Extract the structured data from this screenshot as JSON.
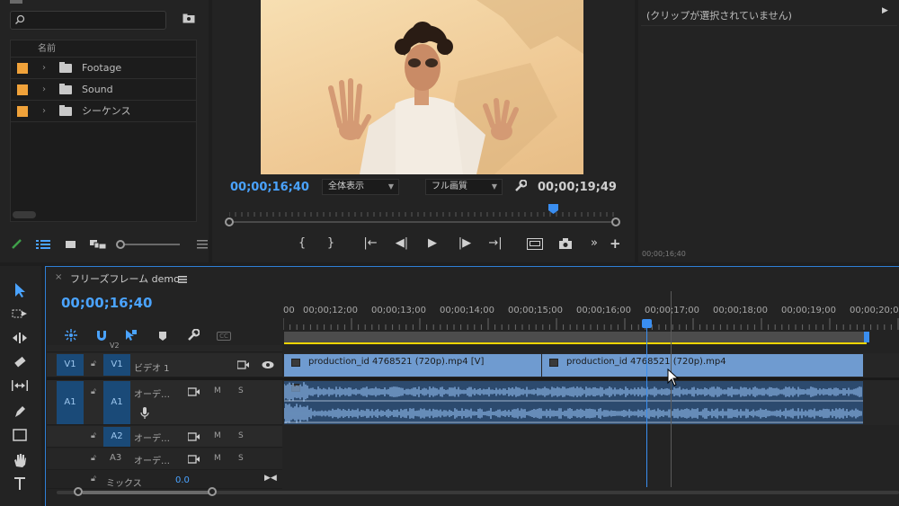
{
  "project": {
    "column_header": "名前",
    "bins": [
      {
        "label": "Footage",
        "color": "#f0a23a"
      },
      {
        "label": "Sound",
        "color": "#f0a23a"
      },
      {
        "label": "シーケンス",
        "color": "#f0a23a"
      }
    ]
  },
  "program": {
    "timecode_current": "00;00;16;40",
    "timecode_duration": "00;00;19;49",
    "zoom_select": "全体表示",
    "quality_select": "フル画質",
    "transport": [
      "{",
      "}",
      "|←",
      "◀|",
      "▶",
      "|▶",
      "→|"
    ]
  },
  "info": {
    "message": "(クリップが選択されていません)",
    "timecode": "00;00;16;40"
  },
  "timeline": {
    "sequence_name": "フリーズフレーム demo",
    "timecode": "00;00;16;40",
    "ruler_labels": [
      "00",
      "00;00;12;00",
      "00;00;13;00",
      "00;00;14;00",
      "00;00;15;00",
      "00;00;16;00",
      "00;00;17;00",
      "00;00;18;00",
      "00;00;19;00",
      "00;00;20;0"
    ],
    "tracks": {
      "v2_label": "V2",
      "v1_source": "V1",
      "v1_target": "V1",
      "v1_name": "ビデオ 1",
      "a1_source": "A1",
      "a1_target": "A1",
      "a1_name": "オーデ…",
      "a2_target": "A2",
      "a2_name": "オーデ…",
      "a3_target": "A3",
      "a3_name": "オーデ…",
      "mix_label": "ミックス",
      "mix_value": "0.0",
      "m_label": "M",
      "s_label": "S"
    },
    "clips": {
      "clip1": "production_id 4768521 (720p).mp4 [V]",
      "clip2": "production_id 4768521 (720p).mp4"
    }
  },
  "colors": {
    "accent": "#4aa3ff",
    "clip": "#6f9bd0",
    "bin_label": "#f0a23a",
    "in_out": "#f2d400"
  }
}
